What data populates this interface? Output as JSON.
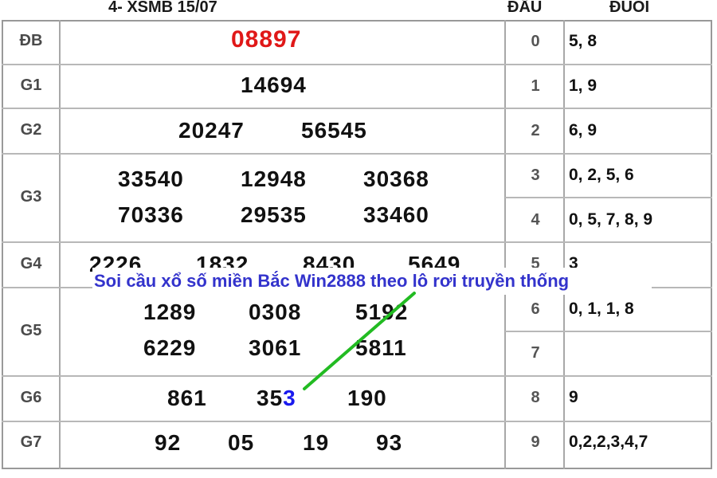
{
  "header": {
    "title": "4- XSMB 15/07",
    "col_dau": "ĐẦU",
    "col_duoi": "ĐUÔI"
  },
  "prizes": {
    "db": {
      "label": "ĐB",
      "numbers": [
        "08897"
      ]
    },
    "g1": {
      "label": "G1",
      "numbers": [
        "14694"
      ]
    },
    "g2": {
      "label": "G2",
      "numbers": [
        "20247",
        "56545"
      ]
    },
    "g3": {
      "label": "G3",
      "numbers": [
        "33540",
        "12948",
        "30368",
        "70336",
        "29535",
        "33460"
      ]
    },
    "g4": {
      "label": "G4",
      "numbers": [
        "2226",
        "1832",
        "8430",
        "5649"
      ]
    },
    "g5": {
      "label": "G5",
      "numbers": [
        "1289",
        "0308",
        "5192",
        "6229",
        "3061",
        "5811"
      ]
    },
    "g6": {
      "label": "G6",
      "numbers": [
        "861",
        "35",
        "3",
        "190"
      ]
    },
    "g7": {
      "label": "G7",
      "numbers": [
        "92",
        "05",
        "19",
        "93"
      ]
    }
  },
  "loto": [
    {
      "dau": "0",
      "duoi": "5, 8"
    },
    {
      "dau": "1",
      "duoi": "1, 9"
    },
    {
      "dau": "2",
      "duoi": "6, 9"
    },
    {
      "dau": "3",
      "duoi": "0, 2, 5, 6"
    },
    {
      "dau": "4",
      "duoi": "0, 5, 7, 8, 9"
    },
    {
      "dau": "5",
      "duoi": "3"
    },
    {
      "dau": "6",
      "duoi": "0, 1, 1, 8"
    },
    {
      "dau": "7",
      "duoi": ""
    },
    {
      "dau": "8",
      "duoi": "9"
    },
    {
      "dau": "9",
      "duoi": "0,2,2,3,4,7"
    }
  ],
  "overlay_title": "Soi cầu xổ số miền Bắc Win2888 theo lô rơi truyền thống",
  "colors": {
    "special": "#e01818",
    "highlight": "#1a1aee",
    "line": "#22bb22",
    "overlay_text": "#3333cc"
  }
}
